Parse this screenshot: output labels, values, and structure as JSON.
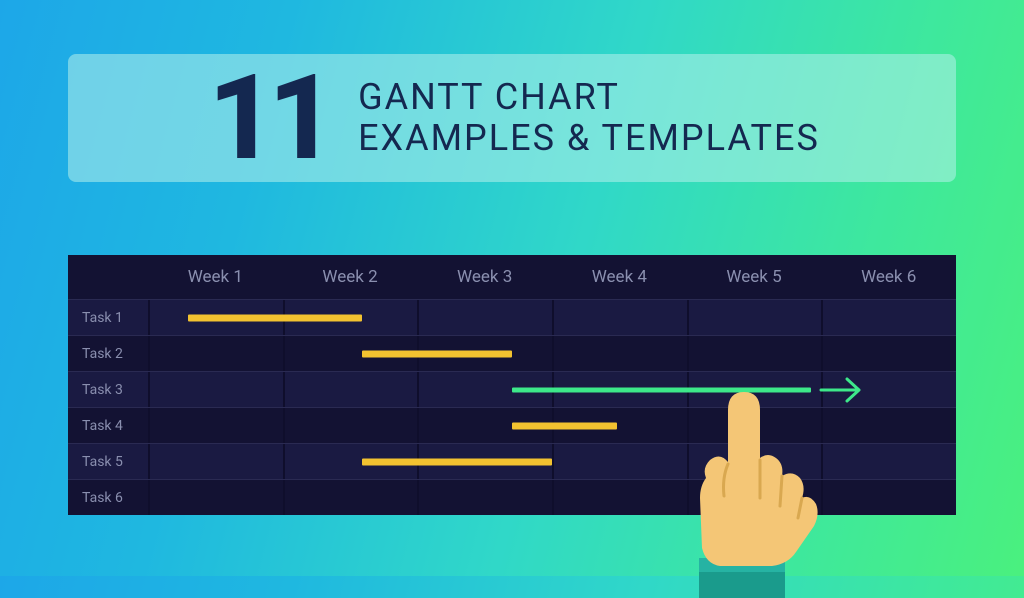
{
  "title": {
    "number": "11",
    "line1": "GANTT CHART",
    "line2": "EXAMPLES & TEMPLATES"
  },
  "columns": [
    "Week 1",
    "Week 2",
    "Week 3",
    "Week 4",
    "Week 5",
    "Week 6"
  ],
  "rows": [
    "Task 1",
    "Task 2",
    "Task 3",
    "Task 4",
    "Task 5",
    "Task 6"
  ],
  "chart_data": {
    "type": "bar",
    "title": "11 Gantt Chart Examples & Templates",
    "xlabel": "Week",
    "ylabel": "Task",
    "categories": [
      "Task 1",
      "Task 2",
      "Task 3",
      "Task 4",
      "Task 5",
      "Task 6"
    ],
    "x_ticks": [
      "Week 1",
      "Week 2",
      "Week 3",
      "Week 4",
      "Week 5",
      "Week 6"
    ],
    "series": [
      {
        "name": "Task 1",
        "start": 0.3,
        "end": 1.6,
        "color": "#f2c230"
      },
      {
        "name": "Task 2",
        "start": 1.6,
        "end": 2.7,
        "color": "#f2c230"
      },
      {
        "name": "Task 3",
        "start": 2.7,
        "end": 5.0,
        "color": "#3de88a",
        "annotation": "drag-arrow"
      },
      {
        "name": "Task 4",
        "start": 2.7,
        "end": 3.5,
        "color": "#f2c230"
      },
      {
        "name": "Task 5",
        "start": 1.6,
        "end": 3.0,
        "color": "#f2c230"
      },
      {
        "name": "Task 6",
        "start": null,
        "end": null
      }
    ],
    "xlim": [
      0,
      6
    ]
  }
}
